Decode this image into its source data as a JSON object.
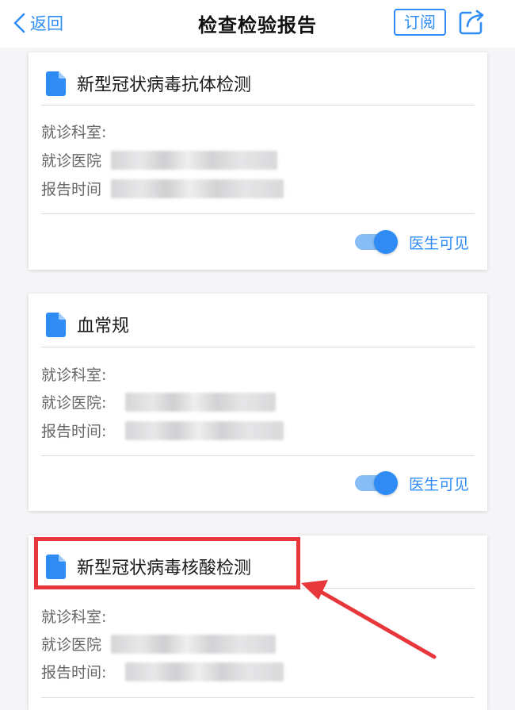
{
  "nav": {
    "back_label": "返回",
    "title": "检查检验报告",
    "subscribe_label": "订阅"
  },
  "reports": [
    {
      "title": "新型冠状病毒抗体检测",
      "department_label": "就诊科室:",
      "hospital_label": "就诊医院",
      "time_label": "报告时间",
      "toggle_label": "医生可见",
      "toggle_on": true
    },
    {
      "title": "血常规",
      "department_label": "就诊科室:",
      "hospital_label": "就诊医院:",
      "time_label": "报告时间:",
      "toggle_label": "医生可见",
      "toggle_on": true
    },
    {
      "title": "新型冠状病毒核酸检测",
      "department_label": "就诊科室:",
      "hospital_label": "就诊医院",
      "time_label": "报告时间:"
    }
  ],
  "colors": {
    "accent": "#2f8cf5",
    "toggle_track": "#87bdf6",
    "annotation": "#e8373a",
    "background": "#f5f5f7"
  },
  "icons": {
    "back": "chevron-left-icon",
    "share": "share-icon",
    "document": "document-icon"
  }
}
